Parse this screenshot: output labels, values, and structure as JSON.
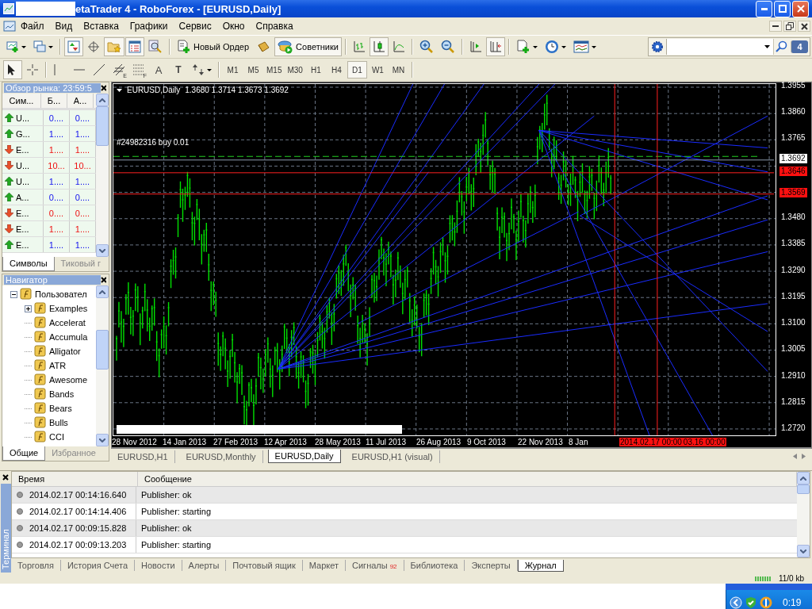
{
  "window": {
    "title": "etaTrader 4 - RoboForex - [EURUSD,Daily]"
  },
  "menu": [
    "Файл",
    "Вид",
    "Вставка",
    "Графики",
    "Сервис",
    "Окно",
    "Справка"
  ],
  "toolbar": [
    {
      "kind": "new-chart",
      "pressed": false
    },
    {
      "kind": "profiles",
      "pressed": false
    },
    {
      "kind": "sep"
    },
    {
      "kind": "market-watch",
      "pressed": true
    },
    {
      "kind": "data-window",
      "pressed": false
    },
    {
      "kind": "navigator",
      "pressed": true
    },
    {
      "kind": "terminal",
      "pressed": true
    },
    {
      "kind": "tester",
      "pressed": false
    },
    {
      "kind": "sep"
    },
    {
      "kind": "new-order",
      "label": "Новый Ордер",
      "pressed": false
    },
    {
      "kind": "gold",
      "pressed": false
    },
    {
      "kind": "experts",
      "label": "Советники",
      "pressed": true
    },
    {
      "kind": "sep"
    },
    {
      "kind": "bars",
      "pressed": false
    },
    {
      "kind": "candles",
      "pressed": true
    },
    {
      "kind": "line",
      "pressed": false
    },
    {
      "kind": "sep"
    },
    {
      "kind": "zoom-in",
      "pressed": false
    },
    {
      "kind": "zoom-out",
      "pressed": false
    },
    {
      "kind": "sep"
    },
    {
      "kind": "autoscroll",
      "pressed": false
    },
    {
      "kind": "shift",
      "pressed": true
    },
    {
      "kind": "sep"
    },
    {
      "kind": "indicators",
      "pressed": false
    },
    {
      "kind": "periods",
      "pressed": false
    },
    {
      "kind": "templates",
      "pressed": false
    }
  ],
  "drawing_toolbar": [
    {
      "kind": "cursor",
      "pressed": true
    },
    {
      "kind": "crosshair",
      "pressed": false
    },
    {
      "kind": "sep"
    },
    {
      "kind": "vline",
      "pressed": false
    },
    {
      "kind": "hline",
      "pressed": false
    },
    {
      "kind": "trend",
      "pressed": false
    },
    {
      "kind": "channel",
      "label": "E",
      "pressed": false
    },
    {
      "kind": "fibo",
      "label": "F",
      "pressed": false
    },
    {
      "kind": "text",
      "label": "A",
      "pressed": false
    },
    {
      "kind": "textlabel",
      "label": "T",
      "pressed": false
    },
    {
      "kind": "arrows",
      "pressed": false
    }
  ],
  "timeframes": [
    {
      "label": "M1",
      "selected": false
    },
    {
      "label": "M5",
      "selected": false
    },
    {
      "label": "M15",
      "selected": false
    },
    {
      "label": "M30",
      "selected": false
    },
    {
      "label": "H1",
      "selected": false
    },
    {
      "label": "H4",
      "selected": false
    },
    {
      "label": "D1",
      "selected": true
    },
    {
      "label": "W1",
      "selected": false
    },
    {
      "label": "MN",
      "selected": false
    }
  ],
  "search": {
    "badge": "4"
  },
  "market_watch": {
    "title": "Обзор рынка: 23:59:5",
    "columns": [
      "Сим...",
      "Б...",
      "А..."
    ],
    "rows": [
      {
        "rising": true,
        "symbol": "U...",
        "bid": "0....",
        "ask": "0...."
      },
      {
        "rising": true,
        "symbol": "G...",
        "bid": "1....",
        "ask": "1...."
      },
      {
        "rising": false,
        "symbol": "E...",
        "bid": "1....",
        "ask": "1...."
      },
      {
        "rising": false,
        "symbol": "U...",
        "bid": "10...",
        "ask": "10..."
      },
      {
        "rising": true,
        "symbol": "U...",
        "bid": "1....",
        "ask": "1...."
      },
      {
        "rising": true,
        "symbol": "A...",
        "bid": "0....",
        "ask": "0...."
      },
      {
        "rising": false,
        "symbol": "E...",
        "bid": "0....",
        "ask": "0...."
      },
      {
        "rising": false,
        "symbol": "E...",
        "bid": "1....",
        "ask": "1...."
      },
      {
        "rising": true,
        "symbol": "E...",
        "bid": "1....",
        "ask": "1...."
      }
    ],
    "tabs": [
      {
        "label": "Символы",
        "selected": true
      },
      {
        "label": "Тиковый г",
        "selected": false
      }
    ]
  },
  "navigator": {
    "title": "Навигатор",
    "tree": [
      {
        "label": "Пользовател",
        "expanded": true,
        "children": [
          {
            "label": "Examples",
            "expanded": false
          },
          {
            "label": "Accelerat"
          },
          {
            "label": "Accumula"
          },
          {
            "label": "Alligator"
          },
          {
            "label": "ATR"
          },
          {
            "label": "Awesome"
          },
          {
            "label": "Bands"
          },
          {
            "label": "Bears"
          },
          {
            "label": "Bulls"
          },
          {
            "label": "CCI"
          }
        ]
      }
    ],
    "tabs": [
      {
        "label": "Общие",
        "selected": true
      },
      {
        "label": "Избранное",
        "selected": false
      }
    ]
  },
  "chart": {
    "symbol": "EURUSD,Daily",
    "ohlc": "1.3680 1.3714 1.3673 1.3692",
    "order_label": "#24982316 buy 0.01",
    "price_labels": [
      {
        "text": "1.3955",
        "kind": "tick"
      },
      {
        "text": "1.3860",
        "kind": "tick"
      },
      {
        "text": "1.3765",
        "kind": "tick"
      },
      {
        "text": "1.3692",
        "kind": "bid"
      },
      {
        "text": "1.3646",
        "kind": "line"
      },
      {
        "text": "1.3569",
        "kind": "line"
      },
      {
        "text": "1.3480",
        "kind": "tick"
      },
      {
        "text": "1.3385",
        "kind": "tick"
      },
      {
        "text": "1.3290",
        "kind": "tick"
      },
      {
        "text": "1.3195",
        "kind": "tick"
      },
      {
        "text": "1.3100",
        "kind": "tick"
      },
      {
        "text": "1.3005",
        "kind": "tick"
      },
      {
        "text": "1.2910",
        "kind": "tick"
      },
      {
        "text": "1.2815",
        "kind": "tick"
      },
      {
        "text": "1.2720",
        "kind": "tick"
      }
    ],
    "date_labels": [
      "28 Nov 2012",
      "14 Jan 2013",
      "27 Feb 2013",
      "12 Apr 2013",
      "28 May 2013",
      "11 Jul 2013",
      "26 Aug 2013",
      "9 Oct 2013",
      "22 Nov 2013",
      "8 Jan"
    ],
    "cursor_labels": [
      "2014.02.17 00:00",
      "03.16 00:00"
    ]
  },
  "chart_tabs": [
    {
      "label": "EURUSD,H1",
      "selected": false
    },
    {
      "label": "EURUSD,Monthly",
      "selected": false
    },
    {
      "label": "EURUSD,Daily",
      "selected": true
    },
    {
      "label": "EURUSD,H1 (visual)",
      "selected": false
    }
  ],
  "terminal": {
    "title": "Терминал",
    "columns": [
      "Время",
      "Сообщение"
    ],
    "rows": [
      {
        "time": "2014.02.17 00:14:16.640",
        "message": "Publisher: ok"
      },
      {
        "time": "2014.02.17 00:14:14.406",
        "message": "Publisher: starting"
      },
      {
        "time": "2014.02.17 00:09:15.828",
        "message": "Publisher: ok"
      },
      {
        "time": "2014.02.17 00:09:13.203",
        "message": "Publisher: starting"
      }
    ],
    "tabs": [
      {
        "label": "Торговля",
        "selected": false
      },
      {
        "label": "История Счета",
        "selected": false
      },
      {
        "label": "Новости",
        "selected": false
      },
      {
        "label": "Алерты",
        "selected": false
      },
      {
        "label": "Почтовый ящик",
        "selected": false
      },
      {
        "label": "Маркет",
        "selected": false
      },
      {
        "label": "Сигналы",
        "badge": "92",
        "selected": false
      },
      {
        "label": "Библиотека",
        "selected": false
      },
      {
        "label": "Эксперты",
        "selected": false
      },
      {
        "label": "Журнал",
        "selected": true
      }
    ]
  },
  "status_bar": {
    "traffic": "11/0 kb"
  },
  "taskbar": {
    "clock": "0:19"
  }
}
